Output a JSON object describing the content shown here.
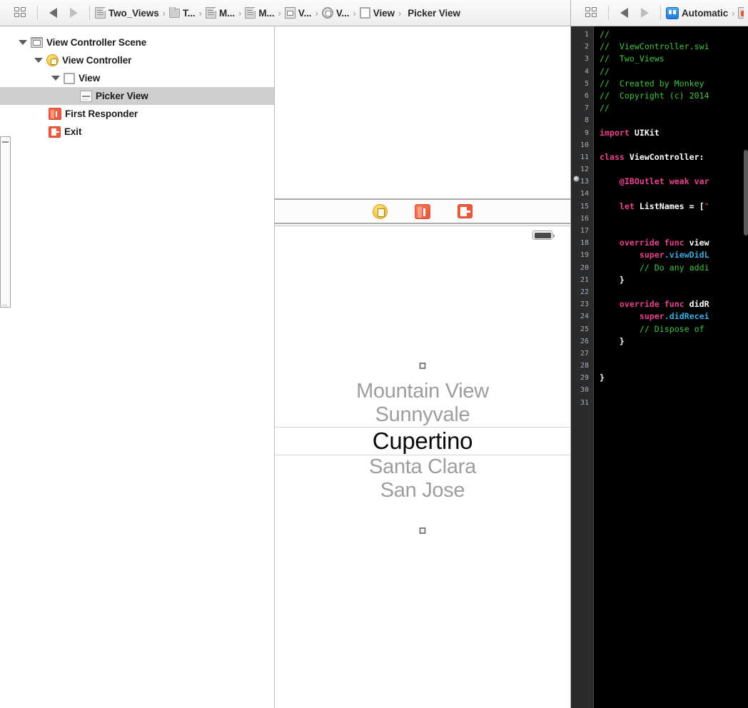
{
  "jumpbar_left": {
    "grid_icon": "grid-icon",
    "back_icon": "back-arrow-icon",
    "forward_icon": "forward-arrow-icon",
    "breadcrumbs": [
      {
        "label": "Two_Views",
        "icon": "document-icon"
      },
      {
        "label": "T...",
        "icon": "folder-icon"
      },
      {
        "label": "M...",
        "icon": "document-icon"
      },
      {
        "label": "M...",
        "icon": "document-icon"
      },
      {
        "label": "V...",
        "icon": "storyboard-icon"
      },
      {
        "label": "V...",
        "icon": "view-controller-icon"
      },
      {
        "label": "View",
        "icon": "view-icon"
      },
      {
        "label": "Picker View",
        "icon": "picker-view-icon"
      }
    ],
    "separator": "›"
  },
  "jumpbar_right": {
    "grid_icon": "grid-icon",
    "back_icon": "back-arrow-icon",
    "forward_icon": "forward-arrow-icon",
    "breadcrumbs": [
      {
        "label": "Automatic",
        "icon": "assistant-editor-icon"
      },
      {
        "label": "",
        "icon": "swift-file-icon"
      }
    ],
    "separator": "›"
  },
  "outline": {
    "items": [
      {
        "label": "View Controller Scene",
        "icon": "scene-icon",
        "indent": 0,
        "twisty": "expanded",
        "selected": false
      },
      {
        "label": "View Controller",
        "icon": "view-controller-icon",
        "indent": 1,
        "twisty": "expanded",
        "selected": false
      },
      {
        "label": "View",
        "icon": "view-icon",
        "indent": 2,
        "twisty": "expanded",
        "selected": false
      },
      {
        "label": "Picker View",
        "icon": "picker-view-icon",
        "indent": 3,
        "twisty": "none",
        "selected": true
      },
      {
        "label": "First Responder",
        "icon": "first-responder-icon",
        "indent": 1,
        "twisty": "none",
        "selected": false
      },
      {
        "label": "Exit",
        "icon": "exit-icon",
        "indent": 1,
        "twisty": "none",
        "selected": false
      }
    ]
  },
  "canvas": {
    "scene_dock": [
      {
        "icon": "view-controller-icon",
        "name": "view-controller"
      },
      {
        "icon": "first-responder-icon",
        "name": "first-responder"
      },
      {
        "icon": "exit-icon",
        "name": "exit"
      }
    ],
    "status_bar": {
      "battery_icon": "battery-icon"
    },
    "picker": {
      "selected": "Cupertino",
      "rows": [
        {
          "label": "Mountain View",
          "selected": false
        },
        {
          "label": "Sunnyvale",
          "selected": false
        },
        {
          "label": "Cupertino",
          "selected": true
        },
        {
          "label": "Santa Clara",
          "selected": false
        },
        {
          "label": "San Jose",
          "selected": false
        }
      ],
      "handle_top": "resize-handle",
      "handle_bottom": "resize-handle"
    }
  },
  "editor": {
    "line_numbers": [
      "1",
      "2",
      "3",
      "4",
      "5",
      "6",
      "7",
      "8",
      "9",
      "10",
      "11",
      "12",
      "13",
      "14",
      "15",
      "16",
      "17",
      "18",
      "19",
      "20",
      "21",
      "22",
      "23",
      "24",
      "25",
      "26",
      "27",
      "28",
      "29",
      "30",
      "31"
    ],
    "fold_marker_line": "13",
    "lines": [
      [
        {
          "t": "//",
          "c": "cmt"
        }
      ],
      [
        {
          "t": "//  ViewController.swi",
          "c": "cmt"
        }
      ],
      [
        {
          "t": "//  Two_Views",
          "c": "cmt"
        }
      ],
      [
        {
          "t": "//",
          "c": "cmt"
        }
      ],
      [
        {
          "t": "//  Created by Monkey",
          "c": "cmt"
        }
      ],
      [
        {
          "t": "//  Copyright (c) 2014",
          "c": "cmt"
        }
      ],
      [
        {
          "t": "//",
          "c": "cmt"
        }
      ],
      [],
      [
        {
          "t": "import ",
          "c": "kw"
        },
        {
          "t": "UIKit",
          "c": "pln"
        }
      ],
      [],
      [
        {
          "t": "class ",
          "c": "kw"
        },
        {
          "t": "ViewController",
          "c": "pln"
        },
        {
          "t": ":",
          "c": "pln"
        }
      ],
      [],
      [
        {
          "t": "    @IBOutlet weak var",
          "c": "kw"
        }
      ],
      [],
      [
        {
          "t": "    let ",
          "c": "kw"
        },
        {
          "t": "ListNames ",
          "c": "pln"
        },
        {
          "t": "= [",
          "c": "pln"
        },
        {
          "t": "\"",
          "c": "str"
        }
      ],
      [],
      [],
      [
        {
          "t": "    override func ",
          "c": "kw"
        },
        {
          "t": "view",
          "c": "pln"
        }
      ],
      [
        {
          "t": "        super",
          "c": "kw"
        },
        {
          "t": ".viewDidL",
          "c": "mth"
        }
      ],
      [
        {
          "t": "        // Do any addi",
          "c": "cmt"
        }
      ],
      [
        {
          "t": "    }",
          "c": "pln"
        }
      ],
      [],
      [
        {
          "t": "    override func ",
          "c": "kw"
        },
        {
          "t": "didR",
          "c": "pln"
        }
      ],
      [
        {
          "t": "        super",
          "c": "kw"
        },
        {
          "t": ".didRecei",
          "c": "mth"
        }
      ],
      [
        {
          "t": "        // Dispose of ",
          "c": "cmt"
        }
      ],
      [
        {
          "t": "    }",
          "c": "pln"
        }
      ],
      [],
      [],
      [
        {
          "t": "}",
          "c": "pln"
        }
      ],
      [],
      []
    ]
  },
  "colors": {
    "selection": "#cfcfcf",
    "comment": "#41c441",
    "keyword": "#e8438f",
    "method": "#3fa9de",
    "string": "#ee4b4b",
    "editor_bg": "#000000",
    "gutter_bg": "#2b2b2b"
  }
}
